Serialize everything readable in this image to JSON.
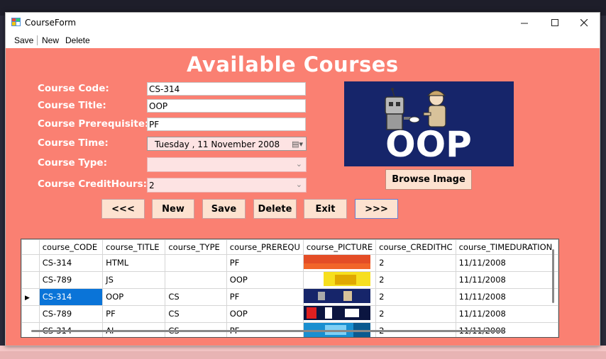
{
  "window": {
    "title": "CourseForm"
  },
  "menu": {
    "save": "Save",
    "new": "New",
    "delete": "Delete"
  },
  "heading": "Available Courses",
  "form": {
    "code_label": "Course Code:",
    "code_value": "CS-314",
    "title_label": "Course Title:",
    "title_value": "OOP",
    "prereq_label": "Course Prerequisite:",
    "prereq_value": "PF",
    "time_label": "Course Time:",
    "time_value": "Tuesday   , 11 November 2008",
    "type_label": "Course Type:",
    "type_value": "",
    "credit_label": "Course CreditHours:",
    "credit_value": "2"
  },
  "picture": {
    "caption": "OOP"
  },
  "buttons": {
    "browse": "Browse Image",
    "prev": "<<<",
    "new": "New",
    "save": "Save",
    "delete": "Delete",
    "exit": "Exit",
    "next": ">>>"
  },
  "grid": {
    "columns": [
      "course_CODE",
      "course_TITLE",
      "course_TYPE",
      "course_PREREQU",
      "course_PICTURE",
      "course_CREDITHC",
      "course_TIMEDURATION"
    ],
    "rows": [
      {
        "code": "CS-314",
        "title": "HTML",
        "type": "",
        "prereq": "PF",
        "credit": "2",
        "time": "11/11/2008"
      },
      {
        "code": "CS-789",
        "title": "JS",
        "type": "",
        "prereq": "OOP",
        "credit": "2",
        "time": "11/11/2008"
      },
      {
        "code": "CS-314",
        "title": "OOP",
        "type": "CS",
        "prereq": "PF",
        "credit": "2",
        "time": "11/11/2008"
      },
      {
        "code": "CS-789",
        "title": "PF",
        "type": "CS",
        "prereq": "OOP",
        "credit": "2",
        "time": "11/11/2008"
      },
      {
        "code": "CS-314",
        "title": "AI",
        "type": "CS",
        "prereq": "PF",
        "credit": "2",
        "time": "11/11/2008"
      }
    ]
  },
  "colors": {
    "form_background": "#fa8072",
    "selection": "#0a74d8",
    "picture_background": "#16256a"
  }
}
